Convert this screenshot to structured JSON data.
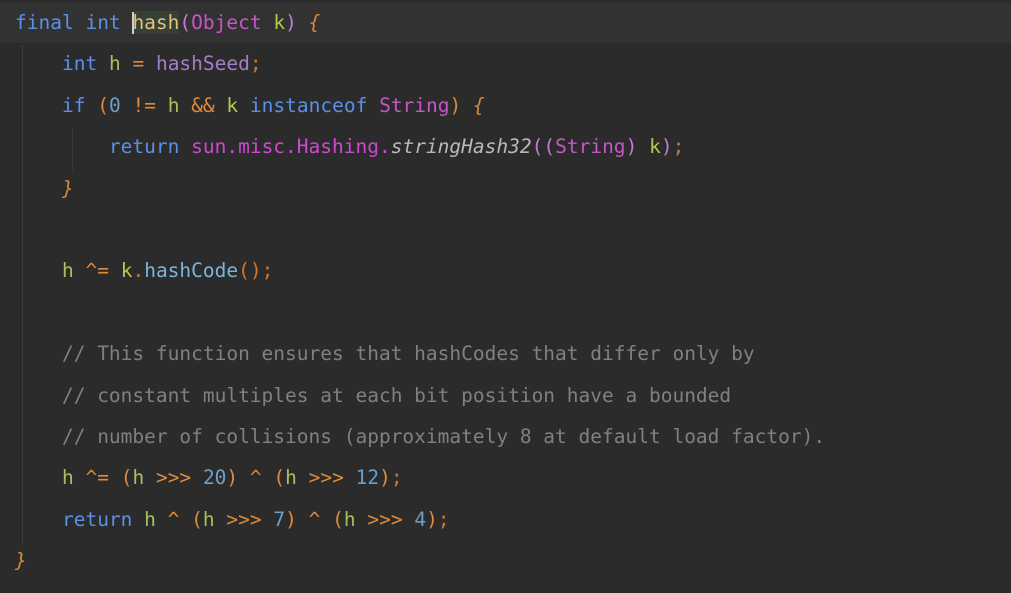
{
  "editor": {
    "lines": [
      {
        "id": "l1",
        "tokens": [
          {
            "t": "final",
            "c": "kw"
          },
          {
            "t": " ",
            "c": ""
          },
          {
            "t": "int",
            "c": "kw"
          },
          {
            "t": " ",
            "c": ""
          },
          {
            "t": "hash",
            "c": "fn",
            "hl": true
          },
          {
            "t": "(",
            "c": "paren"
          },
          {
            "t": "Object",
            "c": "cls"
          },
          {
            "t": " ",
            "c": ""
          },
          {
            "t": "k",
            "c": "param"
          },
          {
            "t": ")",
            "c": "paren"
          },
          {
            "t": " ",
            "c": ""
          },
          {
            "t": "{",
            "c": "brace"
          }
        ]
      },
      {
        "id": "l2",
        "tokens": [
          {
            "t": "    ",
            "c": ""
          },
          {
            "t": "int",
            "c": "kw"
          },
          {
            "t": " ",
            "c": ""
          },
          {
            "t": "h",
            "c": "var"
          },
          {
            "t": " ",
            "c": ""
          },
          {
            "t": "=",
            "c": "op"
          },
          {
            "t": " ",
            "c": ""
          },
          {
            "t": "hashSeed",
            "c": "field"
          },
          {
            "t": ";",
            "c": "punc"
          }
        ]
      },
      {
        "id": "l3",
        "tokens": [
          {
            "t": "    ",
            "c": ""
          },
          {
            "t": "if",
            "c": "kw"
          },
          {
            "t": " ",
            "c": ""
          },
          {
            "t": "(",
            "c": "op"
          },
          {
            "t": "0",
            "c": "num"
          },
          {
            "t": " ",
            "c": ""
          },
          {
            "t": "!=",
            "c": "op"
          },
          {
            "t": " ",
            "c": ""
          },
          {
            "t": "h",
            "c": "var"
          },
          {
            "t": " ",
            "c": ""
          },
          {
            "t": "&&",
            "c": "op"
          },
          {
            "t": " ",
            "c": ""
          },
          {
            "t": "k",
            "c": "param"
          },
          {
            "t": " ",
            "c": ""
          },
          {
            "t": "instanceof",
            "c": "kw"
          },
          {
            "t": " ",
            "c": ""
          },
          {
            "t": "String",
            "c": "cls"
          },
          {
            "t": ")",
            "c": "op"
          },
          {
            "t": " ",
            "c": ""
          },
          {
            "t": "{",
            "c": "brace"
          }
        ]
      },
      {
        "id": "l4",
        "tokens": [
          {
            "t": "        ",
            "c": ""
          },
          {
            "t": "return",
            "c": "kw"
          },
          {
            "t": " ",
            "c": ""
          },
          {
            "t": "sun.misc.Hashing.",
            "c": "pkg"
          },
          {
            "t": "stringHash32",
            "c": "method"
          },
          {
            "t": "(",
            "c": "paren"
          },
          {
            "t": "(",
            "c": "paren"
          },
          {
            "t": "String",
            "c": "cls"
          },
          {
            "t": ")",
            "c": "paren"
          },
          {
            "t": " ",
            "c": ""
          },
          {
            "t": "k",
            "c": "param"
          },
          {
            "t": ")",
            "c": "paren"
          },
          {
            "t": ";",
            "c": "punc"
          }
        ]
      },
      {
        "id": "l5",
        "tokens": [
          {
            "t": "    ",
            "c": ""
          },
          {
            "t": "}",
            "c": "brace"
          }
        ]
      },
      {
        "id": "l6",
        "tokens": []
      },
      {
        "id": "l7",
        "tokens": [
          {
            "t": "    ",
            "c": ""
          },
          {
            "t": "h",
            "c": "var"
          },
          {
            "t": " ",
            "c": ""
          },
          {
            "t": "^=",
            "c": "op"
          },
          {
            "t": " ",
            "c": ""
          },
          {
            "t": "k",
            "c": "param"
          },
          {
            "t": ".",
            "c": "punc"
          },
          {
            "t": "hashCode",
            "c": "methodcall"
          },
          {
            "t": "()",
            "c": "punc"
          },
          {
            "t": ";",
            "c": "punc"
          }
        ]
      },
      {
        "id": "l8",
        "tokens": []
      },
      {
        "id": "l9",
        "tokens": [
          {
            "t": "    ",
            "c": ""
          },
          {
            "t": "// This function ensures that hashCodes that differ only by",
            "c": "cmt"
          }
        ]
      },
      {
        "id": "l10",
        "tokens": [
          {
            "t": "    ",
            "c": ""
          },
          {
            "t": "// constant multiples at each bit position have a bounded",
            "c": "cmt"
          }
        ]
      },
      {
        "id": "l11",
        "tokens": [
          {
            "t": "    ",
            "c": ""
          },
          {
            "t": "// number of collisions (approximately 8 at default load factor).",
            "c": "cmt"
          }
        ]
      },
      {
        "id": "l12",
        "tokens": [
          {
            "t": "    ",
            "c": ""
          },
          {
            "t": "h",
            "c": "var"
          },
          {
            "t": " ",
            "c": ""
          },
          {
            "t": "^=",
            "c": "op"
          },
          {
            "t": " ",
            "c": ""
          },
          {
            "t": "(",
            "c": "op"
          },
          {
            "t": "h",
            "c": "var"
          },
          {
            "t": " ",
            "c": ""
          },
          {
            "t": ">>>",
            "c": "op"
          },
          {
            "t": " ",
            "c": ""
          },
          {
            "t": "20",
            "c": "num"
          },
          {
            "t": ")",
            "c": "op"
          },
          {
            "t": " ",
            "c": ""
          },
          {
            "t": "^",
            "c": "op"
          },
          {
            "t": " ",
            "c": ""
          },
          {
            "t": "(",
            "c": "op"
          },
          {
            "t": "h",
            "c": "var"
          },
          {
            "t": " ",
            "c": ""
          },
          {
            "t": ">>>",
            "c": "op"
          },
          {
            "t": " ",
            "c": ""
          },
          {
            "t": "12",
            "c": "num"
          },
          {
            "t": ")",
            "c": "op"
          },
          {
            "t": ";",
            "c": "punc"
          }
        ]
      },
      {
        "id": "l13",
        "tokens": [
          {
            "t": "    ",
            "c": ""
          },
          {
            "t": "return",
            "c": "kw"
          },
          {
            "t": " ",
            "c": ""
          },
          {
            "t": "h",
            "c": "var"
          },
          {
            "t": " ",
            "c": ""
          },
          {
            "t": "^",
            "c": "op"
          },
          {
            "t": " ",
            "c": ""
          },
          {
            "t": "(",
            "c": "op"
          },
          {
            "t": "h",
            "c": "var"
          },
          {
            "t": " ",
            "c": ""
          },
          {
            "t": ">>>",
            "c": "op"
          },
          {
            "t": " ",
            "c": ""
          },
          {
            "t": "7",
            "c": "num"
          },
          {
            "t": ")",
            "c": "op"
          },
          {
            "t": " ",
            "c": ""
          },
          {
            "t": "^",
            "c": "op"
          },
          {
            "t": " ",
            "c": ""
          },
          {
            "t": "(",
            "c": "op"
          },
          {
            "t": "h",
            "c": "var"
          },
          {
            "t": " ",
            "c": ""
          },
          {
            "t": ">>>",
            "c": "op"
          },
          {
            "t": " ",
            "c": ""
          },
          {
            "t": "4",
            "c": "num"
          },
          {
            "t": ")",
            "c": "op"
          },
          {
            "t": ";",
            "c": "punc"
          }
        ]
      },
      {
        "id": "l14",
        "tokens": [
          {
            "t": "}",
            "c": "brace"
          }
        ]
      }
    ]
  }
}
